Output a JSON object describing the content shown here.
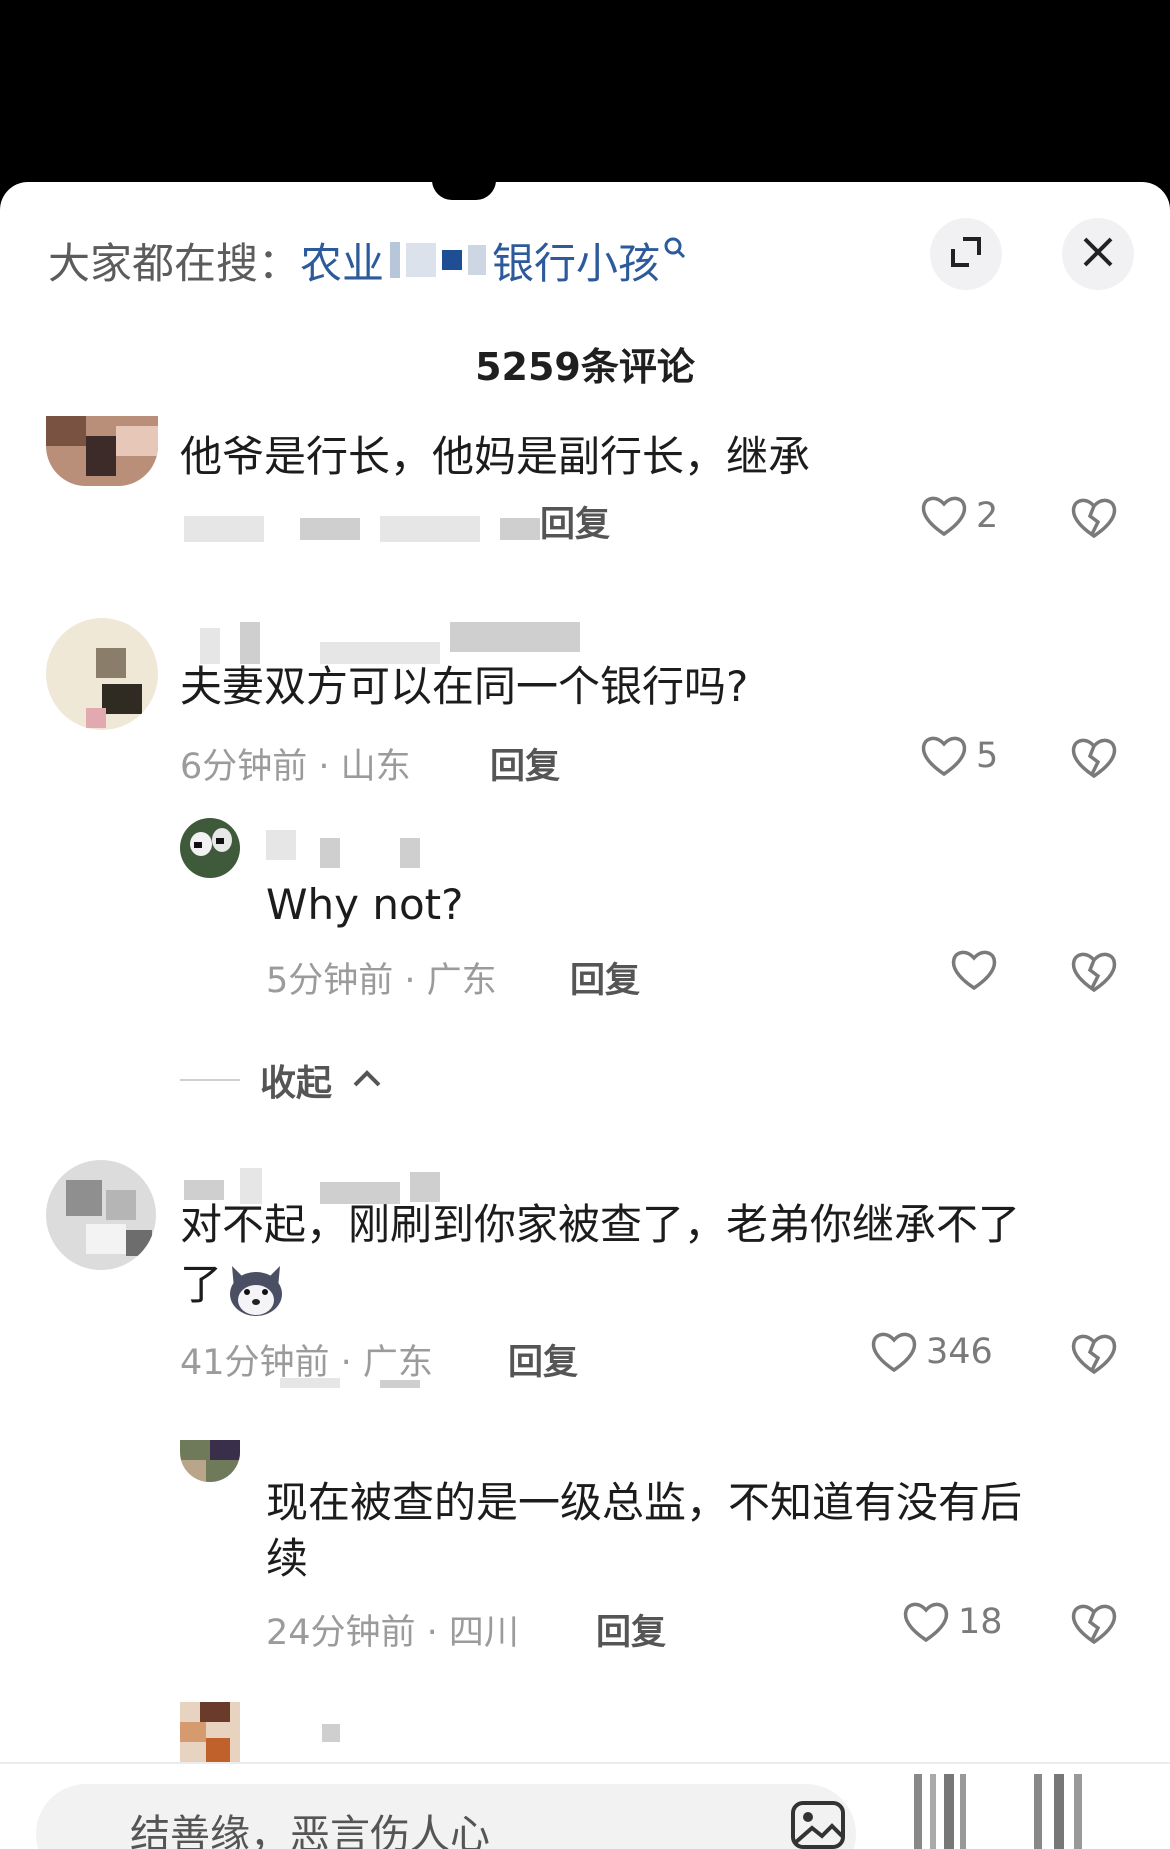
{
  "search_bar": {
    "label": "大家都在搜：",
    "term_prefix": "农业",
    "term_suffix": "银行小孩",
    "icon": "search-icon"
  },
  "header": {
    "comment_count_title": "5259条评论",
    "expand_icon": "expand-icon",
    "close_icon": "close-icon"
  },
  "comments": [
    {
      "text": "他爷是行长，他妈是副行长，继承",
      "meta": "",
      "reply_label": "回复",
      "likes": "2"
    },
    {
      "text": "夫妻双方可以在同一个银行吗?",
      "meta": "6分钟前 · 山东",
      "reply_label": "回复",
      "likes": "5",
      "replies": [
        {
          "text": "Why not?",
          "meta": "5分钟前 · 广东",
          "reply_label": "回复",
          "likes": ""
        }
      ]
    },
    {
      "text_line1": "对不起，刚刷到你家被查了，老弟你继承不了",
      "text_line2": "了",
      "meta": "41分钟前 · 广东",
      "reply_label": "回复",
      "likes": "346",
      "replies": [
        {
          "text_line1": "现在被查的是一级总监，不知道有没有后",
          "text_line2": "续",
          "meta": "24分钟前 · 四川",
          "reply_label": "回复",
          "likes": "18"
        }
      ]
    }
  ],
  "collapse_label": "收起",
  "input": {
    "placeholder": "结善缘，恶言伤人心"
  },
  "colors": {
    "accent_link": "#2d5a9a",
    "meta_gray": "#9b9b9b",
    "text": "#1c1c1c"
  }
}
